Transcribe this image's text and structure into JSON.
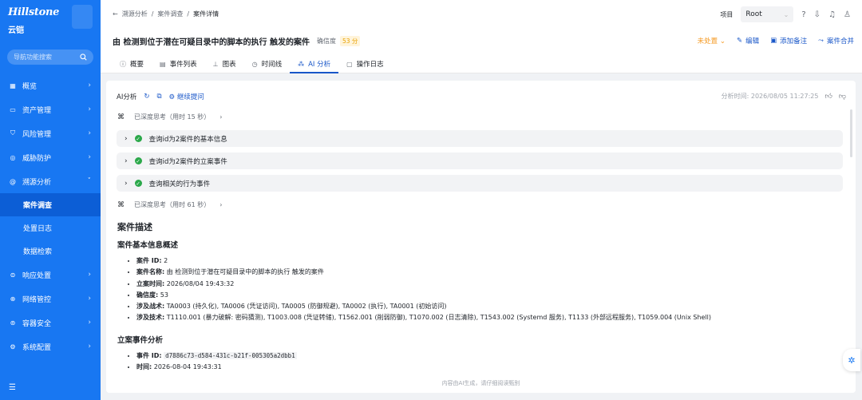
{
  "sidebar": {
    "brand": "Hillstone",
    "brand_sub": "云铠",
    "search_placeholder": "导航功能搜索",
    "items": [
      {
        "label": "概览",
        "icon": "grid-icon"
      },
      {
        "label": "资产管理",
        "icon": "monitor-icon"
      },
      {
        "label": "风险管理",
        "icon": "shield-icon"
      },
      {
        "label": "威胁防护",
        "icon": "target-icon"
      },
      {
        "label": "溯源分析",
        "icon": "trace-icon",
        "expanded": true
      }
    ],
    "subitems": [
      {
        "label": "案件调查",
        "active": true
      },
      {
        "label": "处置日志"
      },
      {
        "label": "数据检索"
      }
    ],
    "items_after": [
      {
        "label": "响应处置",
        "icon": "response-icon"
      },
      {
        "label": "网络管控",
        "icon": "globe-icon"
      },
      {
        "label": "容器安全",
        "icon": "container-icon"
      },
      {
        "label": "系统配置",
        "icon": "gear-icon"
      }
    ]
  },
  "header": {
    "crumbs": [
      "溯源分析",
      "案件调查",
      "案件详情"
    ],
    "project_label": "项目",
    "project_value": "Root",
    "title": "由 检测到位于潜在可疑目录中的脚本的执行 触发的案件",
    "confidence_label": "确信度",
    "confidence_value": "53 分",
    "status": "未处置",
    "edit": "编辑",
    "add_note": "添加备注",
    "merge": "案件合并"
  },
  "tabs": [
    {
      "label": "概要",
      "icon": "info-icon"
    },
    {
      "label": "事件列表",
      "icon": "list-icon"
    },
    {
      "label": "图表",
      "icon": "graph-icon"
    },
    {
      "label": "时间线",
      "icon": "clock-icon"
    },
    {
      "label": "AI 分析",
      "icon": "ai-icon",
      "active": true
    },
    {
      "label": "操作日志",
      "icon": "log-icon"
    }
  ],
  "ai": {
    "label": "AI分析",
    "continue": "继续提问",
    "time_label": "分析时间: 2026/08/05 11:27:25",
    "think1": "已深度思考（用时 15 秒）",
    "steps": [
      "查询id为2案件的基本信息",
      "查询id为2案件的立案事件",
      "查询相关的行为事件"
    ],
    "think2": "已深度思考（用时 61 秒）",
    "h_desc": "案件描述",
    "h_basic": "案件基本信息概述",
    "basic": [
      {
        "k": "案件 ID:",
        "v": " 2"
      },
      {
        "k": "案件名称:",
        "v": " 由 检测到位于潜在可疑目录中的脚本的执行 触发的案件"
      },
      {
        "k": "立案时间:",
        "v": " 2026/08/04 19:43:32"
      },
      {
        "k": "确信度:",
        "v": " 53"
      },
      {
        "k": "涉及战术:",
        "v": " TA0003 (持久化), TA0006 (凭证访问), TA0005 (防御规避), TA0002 (执行), TA0001 (初始访问)"
      },
      {
        "k": "涉及技术:",
        "v": " T1110.001 (暴力破解: 密码猜测), T1003.008 (凭证转储), T1562.001 (削弱防御), T1070.002 (日志清除), T1543.002 (Systemd 服务), T1133 (外部远程服务), T1059.004 (Unix Shell)"
      }
    ],
    "h_event": "立案事件分析",
    "event_id_label": "事件 ID:",
    "event_id": "d7886c73-d584-431c-b21f-005305a2dbb1",
    "event_time_label": "时间:",
    "event_time": " 2026-08-04 19:43:31",
    "footer": "内容由AI生成，请仔细阅读甄别"
  }
}
